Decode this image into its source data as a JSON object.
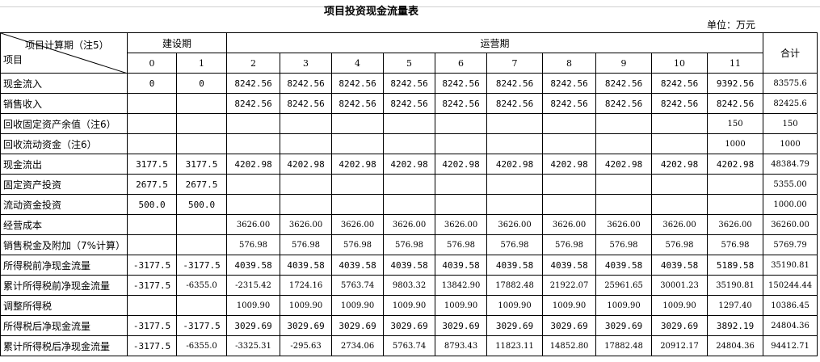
{
  "title": "项目投资现金流量表",
  "unit": "单位：万元",
  "header": {
    "diag_top": "项目计算期（注5）",
    "diag_bottom": "项目",
    "construction": "建设期",
    "operation": "运营期",
    "total": "合计",
    "periods": [
      "0",
      "1",
      "2",
      "3",
      "4",
      "5",
      "6",
      "7",
      "8",
      "9",
      "10",
      "11"
    ]
  },
  "rows": [
    {
      "label": "现金流入",
      "cells": [
        "0",
        "0",
        "8242.56",
        "8242.56",
        "8242.56",
        "8242.56",
        "8242.56",
        "8242.56",
        "8242.56",
        "8242.56",
        "8242.56",
        "9392.56"
      ],
      "total": "83575.6"
    },
    {
      "label": "销售收入",
      "cells": [
        "",
        "",
        "8242.56",
        "8242.56",
        "8242.56",
        "8242.56",
        "8242.56",
        "8242.56",
        "8242.56",
        "8242.56",
        "8242.56",
        "8242.56"
      ],
      "total": "82425.6"
    },
    {
      "label": "回收固定资产余值（注6）",
      "cells": [
        "",
        "",
        "",
        "",
        "",
        "",
        "",
        "",
        "",
        "",
        "",
        "150"
      ],
      "total": "150"
    },
    {
      "label": "回收流动资金（注6）",
      "cells": [
        "",
        "",
        "",
        "",
        "",
        "",
        "",
        "",
        "",
        "",
        "",
        "1000"
      ],
      "total": "1000"
    },
    {
      "label": "现金流出",
      "cells": [
        "3177.5",
        "3177.5",
        "4202.98",
        "4202.98",
        "4202.98",
        "4202.98",
        "4202.98",
        "4202.98",
        "4202.98",
        "4202.98",
        "4202.98",
        "4202.98"
      ],
      "total": "48384.79"
    },
    {
      "label": "固定资产投资",
      "cells": [
        "2677.5",
        "2677.5",
        "",
        "",
        "",
        "",
        "",
        "",
        "",
        "",
        "",
        ""
      ],
      "total": "5355.00"
    },
    {
      "label": "流动资金投资",
      "cells": [
        "500.0",
        "500.0",
        "",
        "",
        "",
        "",
        "",
        "",
        "",
        "",
        "",
        ""
      ],
      "total": "1000.00"
    },
    {
      "label": "经营成本",
      "cells": [
        "",
        "",
        "3626.00",
        "3626.00",
        "3626.00",
        "3626.00",
        "3626.00",
        "3626.00",
        "3626.00",
        "3626.00",
        "3626.00",
        "3626.00"
      ],
      "total": "36260.00"
    },
    {
      "label": "销售税金及附加（7%计算）",
      "cells": [
        "",
        "",
        "576.98",
        "576.98",
        "576.98",
        "576.98",
        "576.98",
        "576.98",
        "576.98",
        "576.98",
        "576.98",
        "576.98"
      ],
      "total": "5769.79"
    },
    {
      "label": "所得税前净现金流量",
      "cells": [
        "-3177.5",
        "-3177.5",
        "4039.58",
        "4039.58",
        "4039.58",
        "4039.58",
        "4039.58",
        "4039.58",
        "4039.58",
        "4039.58",
        "4039.58",
        "5189.58"
      ],
      "total": "35190.81"
    },
    {
      "label": "累计所得税前净现金流量",
      "cells": [
        "-3177.5",
        "-6355.0",
        "-2315.42",
        "1724.16",
        "5763.74",
        "9803.32",
        "13842.90",
        "17882.48",
        "21922.07",
        "25961.65",
        "30001.23",
        "35190.81"
      ],
      "total": "150244.44"
    },
    {
      "label": "调整所得税",
      "cells": [
        "",
        "",
        "1009.90",
        "1009.90",
        "1009.90",
        "1009.90",
        "1009.90",
        "1009.90",
        "1009.90",
        "1009.90",
        "1009.90",
        "1297.40"
      ],
      "total": "10386.45"
    },
    {
      "label": "所得税后净现金流量",
      "cells": [
        "-3177.5",
        "-3177.5",
        "3029.69",
        "3029.69",
        "3029.69",
        "3029.69",
        "3029.69",
        "3029.69",
        "3029.69",
        "3029.69",
        "3029.69",
        "3892.19"
      ],
      "total": "24804.36"
    },
    {
      "label": "累计所得税后净现金流量",
      "cells": [
        "-3177.5",
        "-6355.0",
        "-3325.31",
        "-295.63",
        "2734.06",
        "5763.74",
        "8793.43",
        "11823.11",
        "14852.80",
        "17882.48",
        "20912.17",
        "24804.36"
      ],
      "total": "94412.71"
    }
  ]
}
